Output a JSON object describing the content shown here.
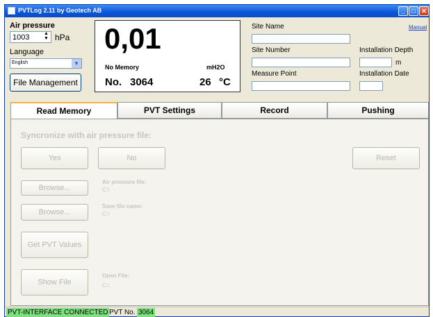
{
  "window": {
    "title": "PVTLog 2.11 by Geotech AB"
  },
  "left": {
    "air_pressure_label": "Air pressure",
    "air_pressure_value": "1003",
    "air_pressure_unit": "hPa",
    "language_label": "Language",
    "language_value": "English",
    "file_management": "File Management"
  },
  "display": {
    "value": "0,01",
    "memory_status": "No Memory",
    "unit": "mH2O",
    "number_label": "No.",
    "number_value": "3064",
    "temperature": "26",
    "temp_unit": "°C"
  },
  "site": {
    "site_name_label": "Site Name",
    "site_number_label": "Site Number",
    "measure_point_label": "Measure Point",
    "manual_link": "Manual",
    "installation_depth_label": "Installation Depth",
    "depth_unit": "m",
    "installation_date_label": "Installation Date"
  },
  "tabs": [
    "Read Memory",
    "PVT Settings",
    "Record",
    "Pushing"
  ],
  "read_memory": {
    "sync_label": "Syncronize with air pressure file:",
    "yes": "Yes",
    "no": "No",
    "reset": "Reset",
    "browse1": "Browse...",
    "air_pressure_file_label": "Air pressure file:",
    "air_pressure_file_value": "C:\\",
    "browse2": "Browse...",
    "save_file_label": "Save file name:",
    "save_file_value": "C:\\",
    "get_pvt_values": "Get PVT Values",
    "show_file": "Show File",
    "open_file_label": "Open File:",
    "open_file_value": "C:\\"
  },
  "status": {
    "connection": "PVT-INTERFACE CONNECTED",
    "pvt_no_label": "PVT No.",
    "pvt_no_value": "3064"
  },
  "colors": {
    "status_green": "#7fe07f",
    "titlebar": "#0a55d8",
    "tab_highlight": "#f7b13e"
  }
}
